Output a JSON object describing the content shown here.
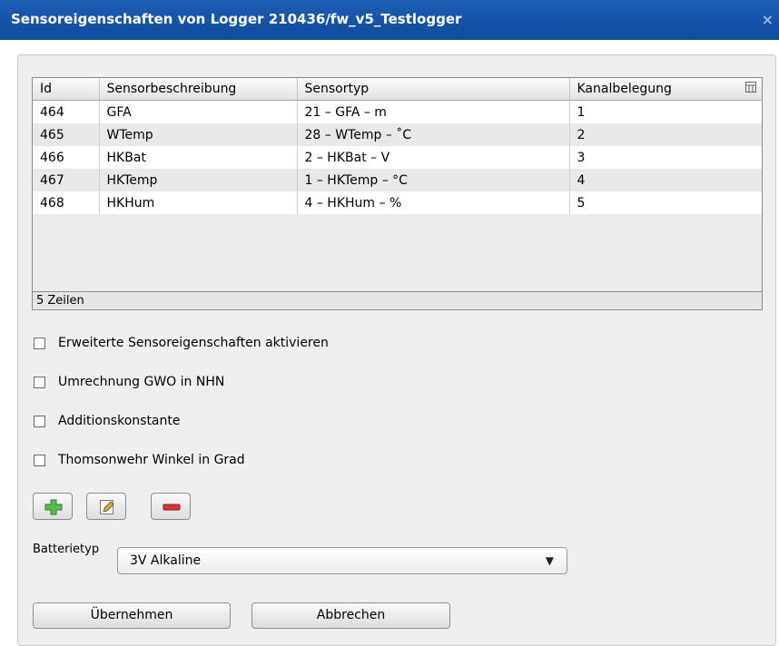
{
  "window": {
    "title": "Sensoreigenschaften von Logger 210436/fw_v5_Testlogger",
    "close_glyph": "×"
  },
  "table": {
    "columns": [
      "Id",
      "Sensorbeschreibung",
      "Sensortyp",
      "Kanalbelegung"
    ],
    "rows": [
      [
        "464",
        "GFA",
        "21 – GFA – m",
        "1"
      ],
      [
        "465",
        "WTemp",
        "28 – WTemp – ˚C",
        "2"
      ],
      [
        "466",
        "HKBat",
        "2 – HKBat – V",
        "3"
      ],
      [
        "467",
        "HKTemp",
        "1 – HKTemp – °C",
        "4"
      ],
      [
        "468",
        "HKHum",
        "4 – HKHum – %",
        "5"
      ]
    ],
    "footer": "5 Zeilen"
  },
  "checkboxes": [
    {
      "label": "Erweiterte Sensoreigenschaften aktivieren",
      "checked": false
    },
    {
      "label": "Umrechnung GWO in NHN",
      "checked": false
    },
    {
      "label": "Additionskonstante",
      "checked": false
    },
    {
      "label": "Thomsonwehr Winkel in Grad",
      "checked": false
    }
  ],
  "toolbar": {
    "add_icon": "plus-icon",
    "edit_icon": "pencil-icon",
    "remove_icon": "minus-icon"
  },
  "battery": {
    "label": "Batterietyp",
    "value": "3V Alkaline"
  },
  "buttons": {
    "apply": "Übernehmen",
    "cancel": "Abbrechen"
  },
  "colors": {
    "titlebar": "#1557aa",
    "add": "#55b548",
    "remove": "#d9333a"
  }
}
